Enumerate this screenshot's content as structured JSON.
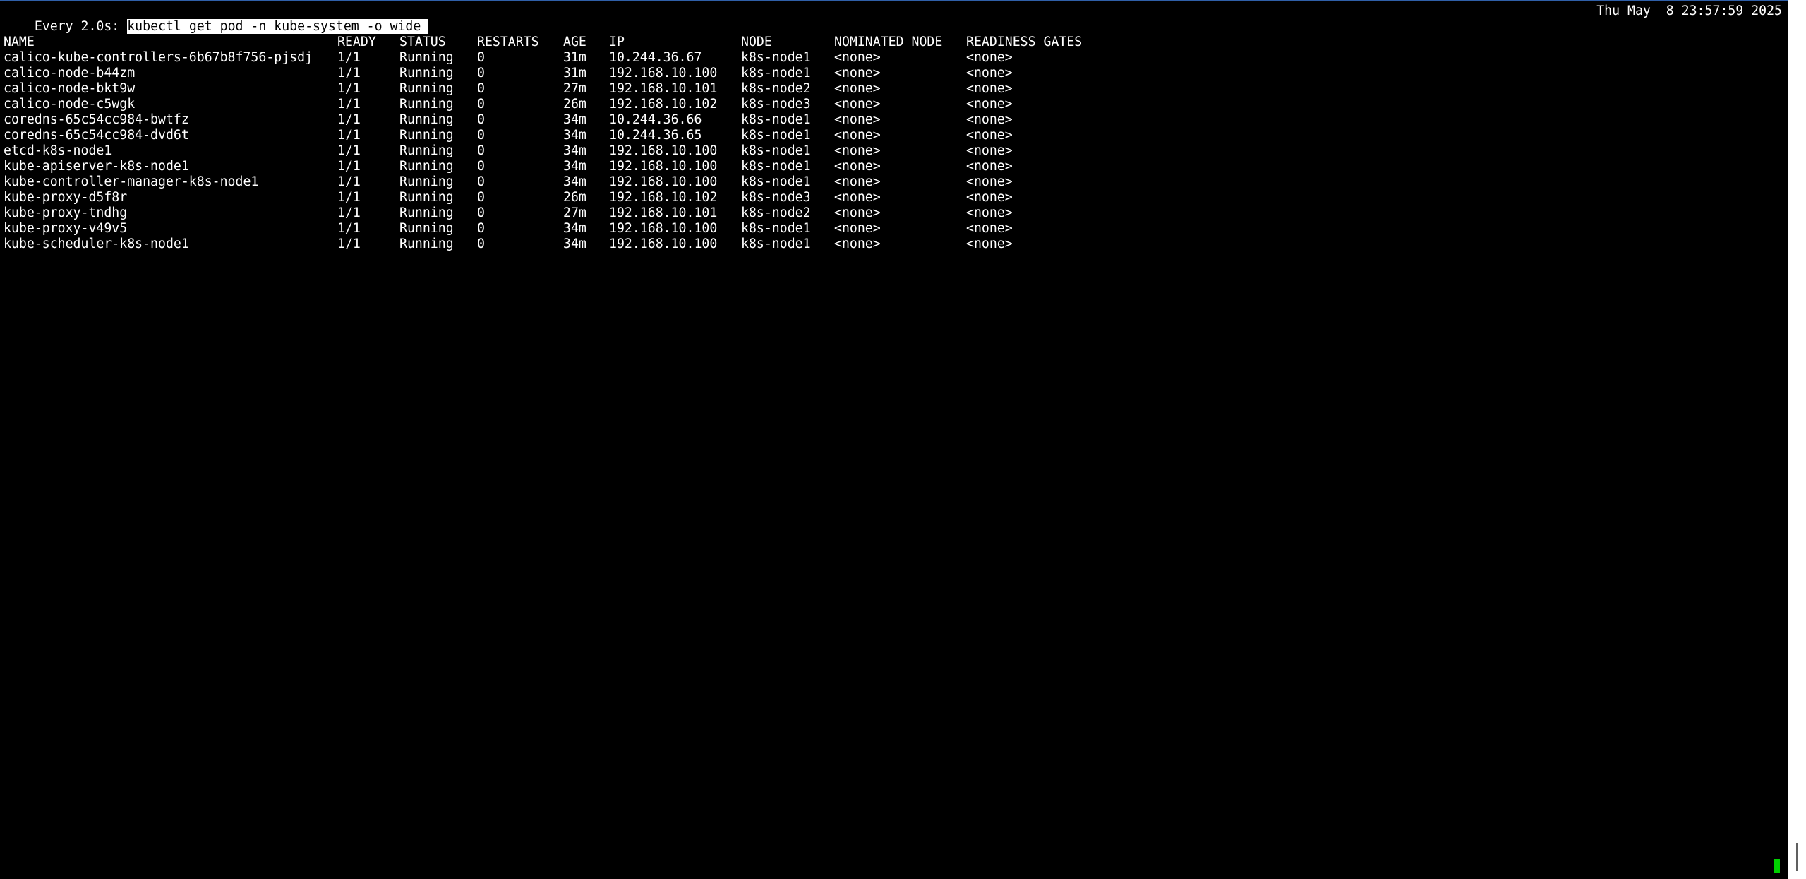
{
  "header": {
    "prefix": "Every 2.0s: ",
    "command": "kubectl get pod -n kube-system -o wide ",
    "datetime": "Thu May  8 23:57:59 2025"
  },
  "columns": {
    "name": "NAME",
    "ready": "READY",
    "status": "STATUS",
    "restarts": "RESTARTS",
    "age": "AGE",
    "ip": "IP",
    "node": "NODE",
    "nominated_node": "NOMINATED NODE",
    "readiness_gates": "READINESS GATES"
  },
  "rows": [
    {
      "name": "calico-kube-controllers-6b67b8f756-pjsdj",
      "ready": "1/1",
      "status": "Running",
      "restarts": "0",
      "age": "31m",
      "ip": "10.244.36.67",
      "node": "k8s-node1",
      "nominated_node": "<none>",
      "readiness_gates": "<none>"
    },
    {
      "name": "calico-node-b44zm",
      "ready": "1/1",
      "status": "Running",
      "restarts": "0",
      "age": "31m",
      "ip": "192.168.10.100",
      "node": "k8s-node1",
      "nominated_node": "<none>",
      "readiness_gates": "<none>"
    },
    {
      "name": "calico-node-bkt9w",
      "ready": "1/1",
      "status": "Running",
      "restarts": "0",
      "age": "27m",
      "ip": "192.168.10.101",
      "node": "k8s-node2",
      "nominated_node": "<none>",
      "readiness_gates": "<none>"
    },
    {
      "name": "calico-node-c5wgk",
      "ready": "1/1",
      "status": "Running",
      "restarts": "0",
      "age": "26m",
      "ip": "192.168.10.102",
      "node": "k8s-node3",
      "nominated_node": "<none>",
      "readiness_gates": "<none>"
    },
    {
      "name": "coredns-65c54cc984-bwtfz",
      "ready": "1/1",
      "status": "Running",
      "restarts": "0",
      "age": "34m",
      "ip": "10.244.36.66",
      "node": "k8s-node1",
      "nominated_node": "<none>",
      "readiness_gates": "<none>"
    },
    {
      "name": "coredns-65c54cc984-dvd6t",
      "ready": "1/1",
      "status": "Running",
      "restarts": "0",
      "age": "34m",
      "ip": "10.244.36.65",
      "node": "k8s-node1",
      "nominated_node": "<none>",
      "readiness_gates": "<none>"
    },
    {
      "name": "etcd-k8s-node1",
      "ready": "1/1",
      "status": "Running",
      "restarts": "0",
      "age": "34m",
      "ip": "192.168.10.100",
      "node": "k8s-node1",
      "nominated_node": "<none>",
      "readiness_gates": "<none>"
    },
    {
      "name": "kube-apiserver-k8s-node1",
      "ready": "1/1",
      "status": "Running",
      "restarts": "0",
      "age": "34m",
      "ip": "192.168.10.100",
      "node": "k8s-node1",
      "nominated_node": "<none>",
      "readiness_gates": "<none>"
    },
    {
      "name": "kube-controller-manager-k8s-node1",
      "ready": "1/1",
      "status": "Running",
      "restarts": "0",
      "age": "34m",
      "ip": "192.168.10.100",
      "node": "k8s-node1",
      "nominated_node": "<none>",
      "readiness_gates": "<none>"
    },
    {
      "name": "kube-proxy-d5f8r",
      "ready": "1/1",
      "status": "Running",
      "restarts": "0",
      "age": "26m",
      "ip": "192.168.10.102",
      "node": "k8s-node3",
      "nominated_node": "<none>",
      "readiness_gates": "<none>"
    },
    {
      "name": "kube-proxy-tndhg",
      "ready": "1/1",
      "status": "Running",
      "restarts": "0",
      "age": "27m",
      "ip": "192.168.10.101",
      "node": "k8s-node2",
      "nominated_node": "<none>",
      "readiness_gates": "<none>"
    },
    {
      "name": "kube-proxy-v49v5",
      "ready": "1/1",
      "status": "Running",
      "restarts": "0",
      "age": "34m",
      "ip": "192.168.10.100",
      "node": "k8s-node1",
      "nominated_node": "<none>",
      "readiness_gates": "<none>"
    },
    {
      "name": "kube-scheduler-k8s-node1",
      "ready": "1/1",
      "status": "Running",
      "restarts": "0",
      "age": "34m",
      "ip": "192.168.10.100",
      "node": "k8s-node1",
      "nominated_node": "<none>",
      "readiness_gates": "<none>"
    }
  ],
  "colors": {
    "background": "#000000",
    "foreground": "#ffffff",
    "cursor": "#00d000",
    "selection_bg": "#ffffff",
    "selection_fg": "#000000"
  }
}
